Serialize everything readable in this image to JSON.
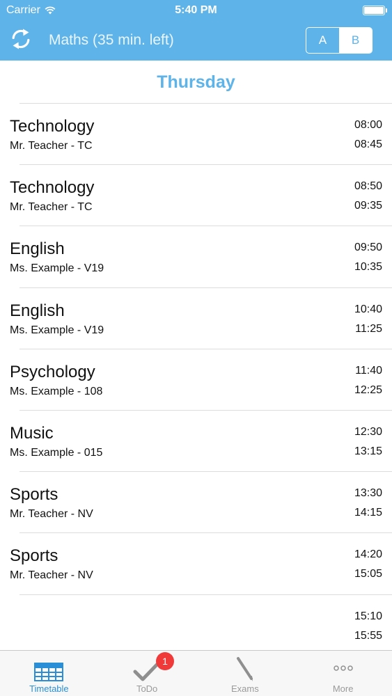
{
  "status_bar": {
    "carrier": "Carrier",
    "time": "5:40 PM"
  },
  "nav": {
    "title": "Maths (35 min. left)",
    "segments": [
      "A",
      "B"
    ],
    "selected_segment": "B"
  },
  "day": "Thursday",
  "lessons": [
    {
      "subject": "Technology",
      "teacher": "Mr. Teacher - TC",
      "start": "08:00",
      "end": "08:45"
    },
    {
      "subject": "Technology",
      "teacher": "Mr. Teacher - TC",
      "start": "08:50",
      "end": "09:35"
    },
    {
      "subject": "English",
      "teacher": "Ms. Example - V19",
      "start": "09:50",
      "end": "10:35"
    },
    {
      "subject": "English",
      "teacher": "Ms. Example - V19",
      "start": "10:40",
      "end": "11:25"
    },
    {
      "subject": "Psychology",
      "teacher": "Ms. Example - 108",
      "start": "11:40",
      "end": "12:25"
    },
    {
      "subject": "Music",
      "teacher": "Ms. Example - 015",
      "start": "12:30",
      "end": "13:15"
    },
    {
      "subject": "Sports",
      "teacher": "Mr. Teacher - NV",
      "start": "13:30",
      "end": "14:15"
    },
    {
      "subject": "Sports",
      "teacher": "Mr. Teacher - NV",
      "start": "14:20",
      "end": "15:05"
    },
    {
      "subject": "",
      "teacher": "",
      "start": "15:10",
      "end": "15:55"
    }
  ],
  "tabs": [
    {
      "label": "Timetable",
      "icon": "table-icon",
      "active": true
    },
    {
      "label": "ToDo",
      "icon": "checkmark-icon",
      "active": false,
      "badge": "1"
    },
    {
      "label": "Exams",
      "icon": "pen-icon",
      "active": false
    },
    {
      "label": "More",
      "icon": "more-dots-icon",
      "active": false
    }
  ],
  "colors": {
    "accent": "#5eb3e8",
    "tab_active": "#2a8fd6",
    "badge": "#f03a3a"
  }
}
